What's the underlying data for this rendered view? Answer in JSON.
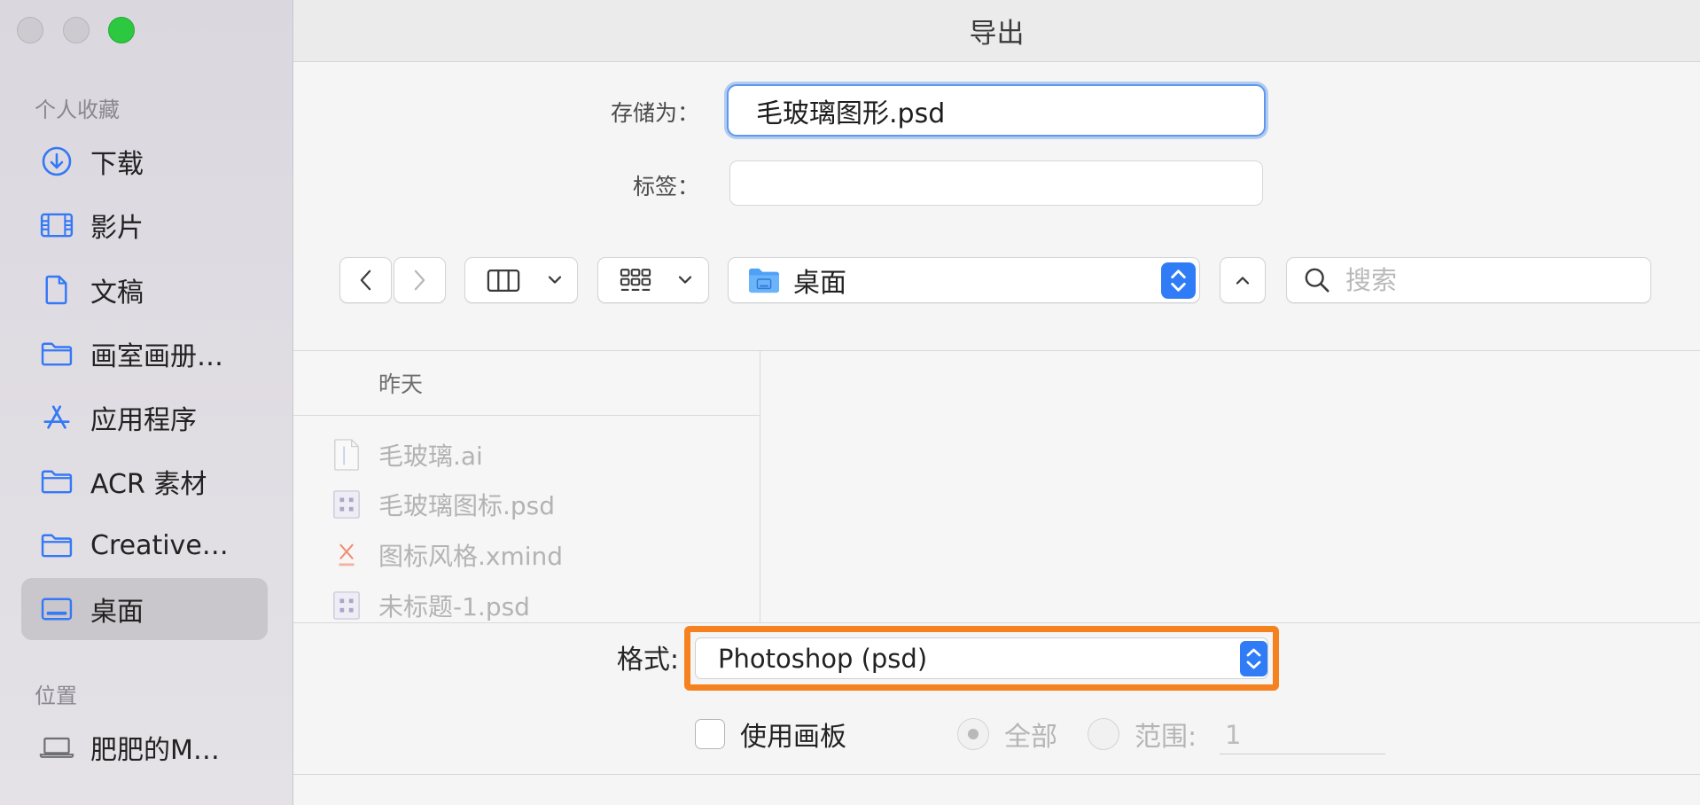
{
  "window": {
    "title": "导出"
  },
  "sidebar": {
    "favorites_header": "个人收藏",
    "favorites": [
      {
        "label": "下载",
        "icon": "download-icon"
      },
      {
        "label": "影片",
        "icon": "film-icon"
      },
      {
        "label": "文稿",
        "icon": "document-icon"
      },
      {
        "label": "画室画册…",
        "icon": "folder-icon"
      },
      {
        "label": "应用程序",
        "icon": "apps-icon"
      },
      {
        "label": "ACR 素材",
        "icon": "folder-icon"
      },
      {
        "label": "Creative…",
        "icon": "folder-icon"
      },
      {
        "label": "桌面",
        "icon": "desktop-icon",
        "selected": true
      }
    ],
    "locations_header": "位置",
    "locations": [
      {
        "label": "肥肥的M…",
        "icon": "laptop-icon"
      }
    ]
  },
  "save_as": {
    "label": "存储为：",
    "filename": "毛玻璃图形.psd"
  },
  "tags": {
    "label": "标签：",
    "value": ""
  },
  "toolbar": {
    "location": "桌面",
    "search_placeholder": "搜索"
  },
  "browser": {
    "group_header": "昨天",
    "files": [
      {
        "name": "毛玻璃.ai",
        "icon": "ai-file-icon"
      },
      {
        "name": "毛玻璃图标.psd",
        "icon": "psd-file-icon"
      },
      {
        "name": "图标风格.xmind",
        "icon": "xmind-file-icon"
      },
      {
        "name": "未标题-1.psd",
        "icon": "psd-file-icon"
      }
    ]
  },
  "format": {
    "label": "格式:",
    "selected": "Photoshop (psd)"
  },
  "options": {
    "use_artboards": {
      "label": "使用画板",
      "checked": false
    },
    "artboard_scope": {
      "all_label": "全部",
      "range_label": "范围:",
      "range_value": "1",
      "selected": "全部",
      "enabled": false
    }
  },
  "colors": {
    "accent": "#3478f6",
    "highlight": "#f5821f",
    "zoom_button": "#2bc840"
  }
}
